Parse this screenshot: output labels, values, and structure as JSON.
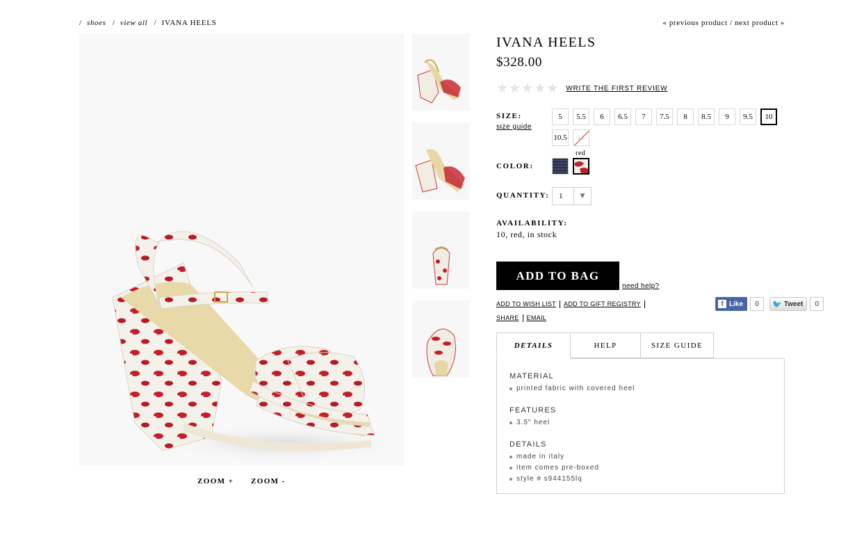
{
  "breadcrumb": {
    "items": [
      "shoes",
      "view all"
    ],
    "current": "IVANA HEELS"
  },
  "product_nav": {
    "previous": "« previous product",
    "separator": "/",
    "next": "next product »"
  },
  "zoom": {
    "in": "ZOOM +",
    "out": "ZOOM -"
  },
  "product": {
    "title": "IVANA HEELS",
    "price": "$328.00"
  },
  "rating": {
    "stars": 0,
    "max": 5,
    "review_link": "WRITE THE FIRST REVIEW"
  },
  "size": {
    "label": "SIZE:",
    "guide": "size guide",
    "options": [
      "5",
      "5.5",
      "6",
      "6.5",
      "7",
      "7.5",
      "8",
      "8.5",
      "9",
      "9.5",
      "10",
      "10.5",
      "11"
    ],
    "selected": "10",
    "unavailable": [
      "11"
    ]
  },
  "color": {
    "label": "COLOR:",
    "selected_name": "red",
    "swatches": [
      "navy",
      "red"
    ]
  },
  "quantity": {
    "label": "QUANTITY:",
    "value": "1"
  },
  "availability": {
    "label": "AVAILABILITY:",
    "value": "10, red, in stock"
  },
  "actions": {
    "add_to_bag": "ADD TO BAG",
    "need_help": "need help?",
    "wish_list": "ADD TO WISH LIST",
    "gift_registry": "ADD TO GIFT REGISTRY",
    "share": "SHARE",
    "email": "EMAIL"
  },
  "social": {
    "like_label": "Like",
    "like_count": "0",
    "tweet_label": "Tweet",
    "tweet_count": "0"
  },
  "tabs": [
    "DETAILS",
    "HELP",
    "SIZE GUIDE"
  ],
  "details": [
    {
      "heading": "MATERIAL",
      "items": [
        "printed fabric with covered heel"
      ]
    },
    {
      "heading": "FEATURES",
      "items": [
        "3.5\" heel"
      ]
    },
    {
      "heading": "DETAILS",
      "items": [
        "made in italy",
        "item comes pre-boxed",
        "style # s944155lq"
      ]
    }
  ]
}
